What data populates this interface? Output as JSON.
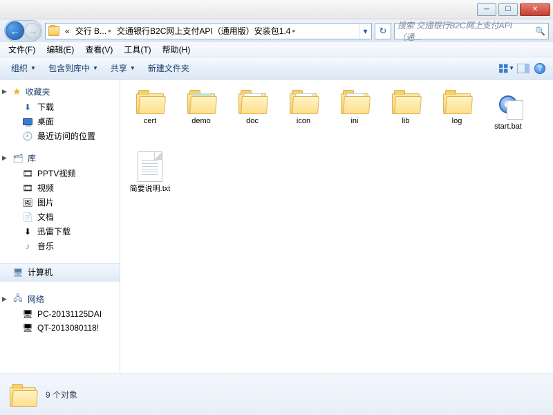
{
  "window": {
    "minimize": "─",
    "maximize": "☐",
    "close": "✕"
  },
  "addressbar": {
    "back_arrow": "←",
    "fwd_arrow": "→",
    "seg_prefix": "«",
    "seg1": "交行 B...",
    "seg2": "交通银行B2C网上支付API（通用版）安装包1.4",
    "triangle": "▸",
    "drop": "▾",
    "refresh": "↻"
  },
  "search": {
    "placeholder": "搜索 交通银行B2C网上支付API（通...",
    "icon": "🔍"
  },
  "menu": {
    "file": "文件(F)",
    "edit": "编辑(E)",
    "view": "查看(V)",
    "tools": "工具(T)",
    "help": "帮助(H)"
  },
  "toolbar": {
    "organize": "组织",
    "include": "包含到库中",
    "share": "共享",
    "newfolder": "新建文件夹"
  },
  "nav": {
    "favorites": "收藏夹",
    "downloads": "下载",
    "desktop": "桌面",
    "recent": "最近访问的位置",
    "library": "库",
    "pptv": "PPTV视频",
    "video": "视频",
    "pictures": "图片",
    "documents": "文档",
    "xunlei": "迅雷下载",
    "music": "音乐",
    "computer": "计算机",
    "network": "网络",
    "pc1": "PC-20131125DAI",
    "pc2": "QT-2013080118!"
  },
  "items": [
    {
      "type": "folder",
      "label": "cert"
    },
    {
      "type": "folder-preview",
      "label": "demo"
    },
    {
      "type": "folder-doc",
      "label": "doc"
    },
    {
      "type": "folder-doc",
      "label": "icon"
    },
    {
      "type": "folder-doc",
      "label": "ini"
    },
    {
      "type": "folder",
      "label": "lib"
    },
    {
      "type": "folder",
      "label": "log"
    },
    {
      "type": "bat",
      "label": "start.bat"
    },
    {
      "type": "txt",
      "label": "简要说明.txt"
    }
  ],
  "status": {
    "count": "9 个对象"
  }
}
